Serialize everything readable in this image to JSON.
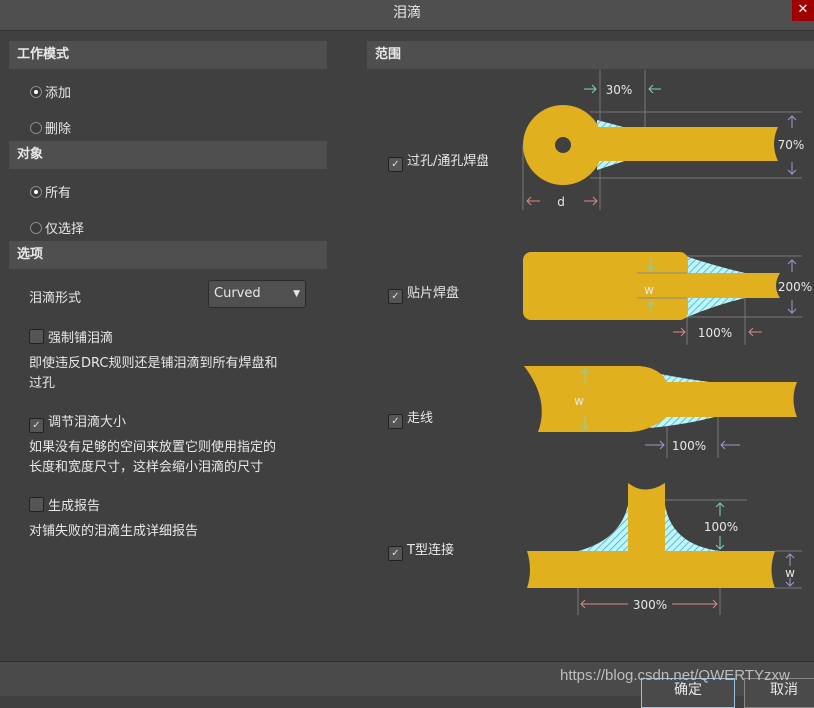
{
  "window": {
    "title": "泪滴",
    "close_icon": "close-icon"
  },
  "left": {
    "mode": {
      "title": "工作模式",
      "options": [
        {
          "label": "添加",
          "selected": true
        },
        {
          "label": "删除",
          "selected": false
        }
      ]
    },
    "target": {
      "title": "对象",
      "options": [
        {
          "label": "所有",
          "selected": true
        },
        {
          "label": "仅选择",
          "selected": false
        }
      ]
    },
    "options": {
      "title": "选项",
      "style_label": "泪滴形式",
      "style_value": "Curved",
      "force": {
        "label": "强制铺泪滴",
        "checked": false,
        "desc": "即使违反DRC规则还是铺泪滴到所有焊盘和",
        "desc2": "过孔"
      },
      "adjust": {
        "label": "调节泪滴大小",
        "checked": true,
        "desc": "如果没有足够的空间来放置它则使用指定的",
        "desc2": "长度和宽度尺寸，这样会缩小泪滴的尺寸"
      },
      "report": {
        "label": "生成报告",
        "checked": false,
        "desc": "对铺失败的泪滴生成详细报告"
      }
    }
  },
  "right": {
    "title": "范围",
    "items": [
      {
        "label": "过孔/通孔焊盘",
        "checked": true,
        "labels": {
          "a": "30%",
          "b": "70%",
          "c": "d"
        }
      },
      {
        "label": "贴片焊盘",
        "checked": true,
        "labels": {
          "a": "w",
          "b": "200%",
          "c": "100%"
        }
      },
      {
        "label": "走线",
        "checked": true,
        "labels": {
          "a": "w",
          "c": "100%"
        }
      },
      {
        "label": "T型连接",
        "checked": true,
        "labels": {
          "a": "100%",
          "b": "w",
          "c": "300%"
        }
      }
    ],
    "colors": {
      "copper": "#e1b01e",
      "hatch": "#8de8f0"
    }
  },
  "footer": {
    "ok": "确定",
    "cancel": "取消",
    "watermark": "https://blog.csdn.net/QWERTYzxw"
  }
}
